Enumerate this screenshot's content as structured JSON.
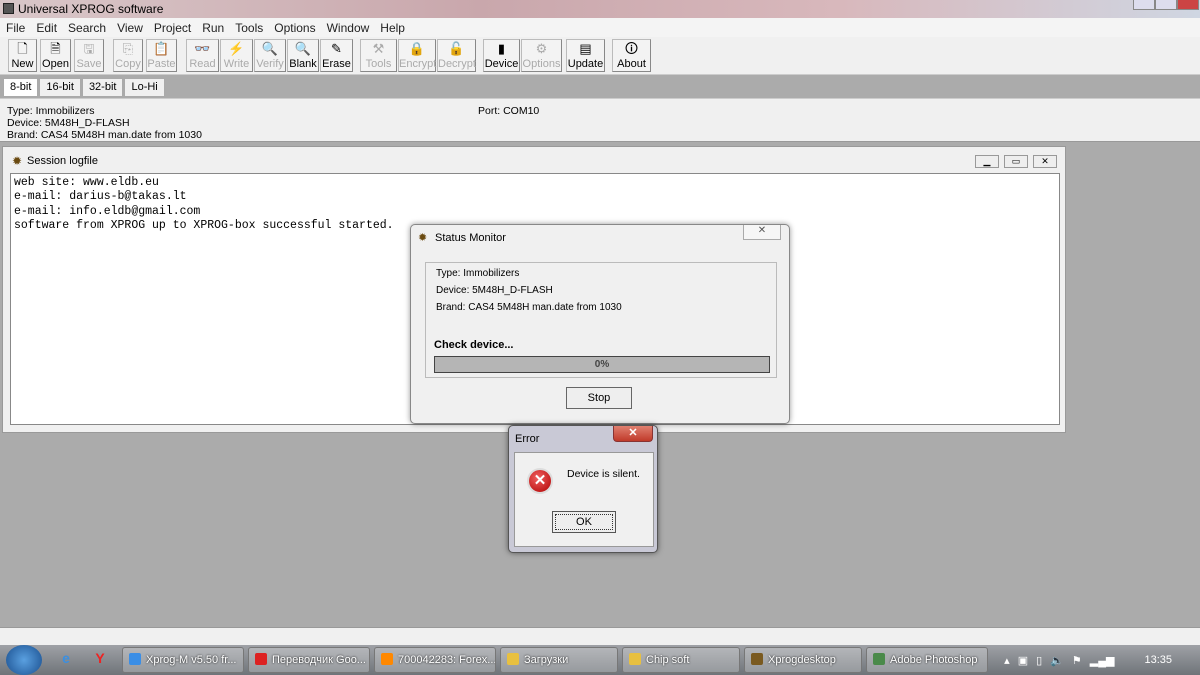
{
  "title": "Universal XPROG software",
  "menu": [
    "File",
    "Edit",
    "Search",
    "View",
    "Project",
    "Run",
    "Tools",
    "Options",
    "Window",
    "Help"
  ],
  "toolbar": [
    {
      "label": "New",
      "icon": "new-file-icon",
      "glyph": "🗋",
      "enabled": true
    },
    {
      "label": "Open",
      "icon": "open-icon",
      "glyph": "🗎",
      "enabled": true
    },
    {
      "label": "Save",
      "icon": "save-icon",
      "glyph": "🖫",
      "enabled": false
    },
    {
      "label": "Copy",
      "icon": "copy-icon",
      "glyph": "⎘",
      "enabled": false
    },
    {
      "label": "Paste",
      "icon": "paste-icon",
      "glyph": "📋",
      "enabled": false
    },
    {
      "label": "Read",
      "icon": "read-icon",
      "glyph": "👓",
      "enabled": false
    },
    {
      "label": "Write",
      "icon": "write-icon",
      "glyph": "⚡",
      "enabled": false
    },
    {
      "label": "Verify",
      "icon": "verify-icon",
      "glyph": "🔍",
      "enabled": false
    },
    {
      "label": "Blank",
      "icon": "blank-check-icon",
      "glyph": "🔍",
      "enabled": true
    },
    {
      "label": "Erase",
      "icon": "erase-icon",
      "glyph": "✎",
      "enabled": true
    },
    {
      "label": "Tools",
      "icon": "tools-icon",
      "glyph": "⚒",
      "enabled": false
    },
    {
      "label": "Encrypt",
      "icon": "lock-icon",
      "glyph": "🔒",
      "enabled": false
    },
    {
      "label": "Decrypt",
      "icon": "unlock-icon",
      "glyph": "🔓",
      "enabled": false
    },
    {
      "label": "Device",
      "icon": "chip-icon",
      "glyph": "▮",
      "enabled": true
    },
    {
      "label": "Options",
      "icon": "options-icon",
      "glyph": "⚙",
      "enabled": false
    },
    {
      "label": "Update",
      "icon": "update-icon",
      "glyph": "▤",
      "enabled": true
    },
    {
      "label": "About",
      "icon": "about-icon",
      "glyph": "🛈",
      "enabled": true
    }
  ],
  "bit_tabs": [
    "8-bit",
    "16-bit",
    "32-bit",
    "Lo-Hi"
  ],
  "info": {
    "type": "Type: Immobilizers",
    "device": "Device: 5M48H_D-FLASH",
    "brand": "Brand: CAS4 5M48H man.date from 1030",
    "port": "Port: COM10"
  },
  "session": {
    "title": "Session logfile",
    "lines": [
      "web site: www.eldb.eu",
      "e-mail: darius-b@takas.lt",
      "e-mail: info.eldb@gmail.com",
      "software from XPROG up to XPROG-box successful started."
    ]
  },
  "status_monitor": {
    "title": "Status Monitor",
    "type": "Type: Immobilizers",
    "device": "Device: 5M48H_D-FLASH",
    "brand": "Brand: CAS4 5M48H man.date from 1030",
    "action": "Check device...",
    "progress_percent": 0,
    "progress_label": "0%",
    "stop_label": "Stop"
  },
  "error_dialog": {
    "title": "Error",
    "message": "Device is silent.",
    "ok_label": "OK"
  },
  "taskbar": {
    "items": [
      {
        "label": "Xprog-M v5.50 fr...",
        "color": "#3a8ee6"
      },
      {
        "label": "Переводчик Goo...",
        "color": "#d22"
      },
      {
        "label": "700042283: Forex...",
        "color": "#f80"
      },
      {
        "label": "Загрузки",
        "color": "#e8c040"
      },
      {
        "label": "Chip soft",
        "color": "#e8c040"
      },
      {
        "label": "Xprogdesktop",
        "color": "#7a5a20"
      },
      {
        "label": "Adobe Photoshop",
        "color": "#4a8a4a"
      }
    ],
    "clock": "13:35"
  }
}
